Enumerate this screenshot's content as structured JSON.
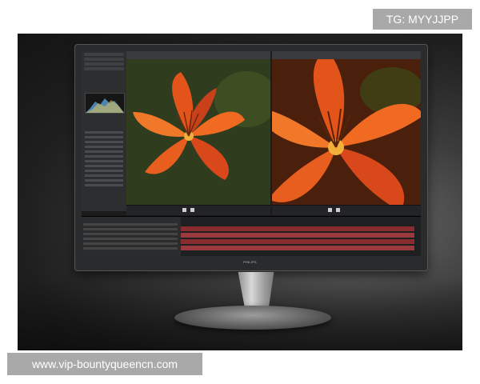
{
  "watermark": {
    "tg": "TG: MYYJJPP",
    "url": "www.vip-bountyqueencn.com"
  },
  "monitor": {
    "brand": "PHILIPS"
  },
  "icons": {
    "play": "play-icon",
    "stop": "stop-icon"
  },
  "colors": {
    "track_red": "#8a2b30",
    "flower_orange": "#e2541a"
  }
}
